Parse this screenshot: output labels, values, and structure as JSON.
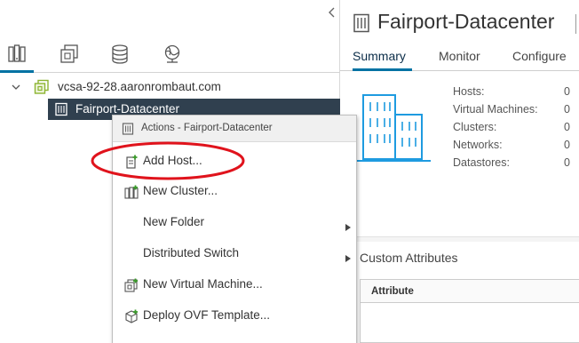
{
  "navigator": {
    "tabs": [
      {
        "icon": "hosts-and-clusters-icon",
        "active": true
      },
      {
        "icon": "vms-and-templates-icon",
        "active": false
      },
      {
        "icon": "storage-icon",
        "active": false
      },
      {
        "icon": "networking-icon",
        "active": false
      }
    ],
    "tree": {
      "vcenter_label": "vcsa-92-28.aaronrombaut.com",
      "datacenter_label": "Fairport-Datacenter"
    }
  },
  "object": {
    "title": "Fairport-Datacenter",
    "tabs": {
      "summary": "Summary",
      "monitor": "Monitor",
      "configure": "Configure"
    },
    "active_tab": "Summary"
  },
  "summary": {
    "stats": [
      {
        "label": "Hosts:",
        "value": "0"
      },
      {
        "label": "Virtual Machines:",
        "value": "0"
      },
      {
        "label": "Clusters:",
        "value": "0"
      },
      {
        "label": "Networks:",
        "value": "0"
      },
      {
        "label": "Datastores:",
        "value": "0"
      }
    ]
  },
  "custom_attributes": {
    "title": "Custom Attributes",
    "column_header": "Attribute"
  },
  "context_menu": {
    "header": "Actions - Fairport-Datacenter",
    "items": [
      {
        "label": "Add Host...",
        "icon": "add-host-icon",
        "submenu": false
      },
      {
        "label": "New Cluster...",
        "icon": "new-cluster-icon",
        "submenu": false
      },
      {
        "label": "New Folder",
        "icon": "",
        "submenu": true
      },
      {
        "label": "Distributed Switch",
        "icon": "",
        "submenu": true
      },
      {
        "label": "New Virtual Machine...",
        "icon": "new-vm-icon",
        "submenu": false
      },
      {
        "label": "Deploy OVF Template...",
        "icon": "deploy-ovf-icon",
        "submenu": false
      }
    ]
  },
  "colors": {
    "accent": "#0072a3",
    "selection": "#30404f",
    "annotation": "#e0131c",
    "illustration": "#1e9be0"
  }
}
